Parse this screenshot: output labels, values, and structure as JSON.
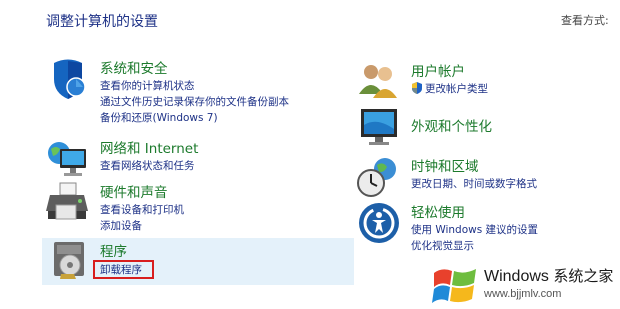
{
  "header": {
    "title": "调整计算机的设置",
    "view_by_label": "查看方式:"
  },
  "categories": {
    "system": {
      "title": "系统和安全",
      "icon": "shield-icon",
      "links": [
        "查看你的计算机状态",
        "通过文件历史记录保存你的文件备份副本",
        "备份和还原(Windows 7)"
      ]
    },
    "network": {
      "title": "网络和 Internet",
      "icon": "network-globe-icon",
      "links": [
        "查看网络状态和任务"
      ]
    },
    "hardware": {
      "title": "硬件和声音",
      "icon": "printer-icon",
      "links": [
        "查看设备和打印机",
        "添加设备"
      ]
    },
    "programs": {
      "title": "程序",
      "icon": "programs-disc-icon",
      "links": [
        "卸载程序"
      ]
    },
    "accounts": {
      "title": "用户帐户",
      "icon": "users-icon",
      "links": [
        "更改帐户类型"
      ]
    },
    "appearance": {
      "title": "外观和个性化",
      "icon": "monitor-icon",
      "links": []
    },
    "clock": {
      "title": "时钟和区域",
      "icon": "clock-globe-icon",
      "links": [
        "更改日期、时间或数字格式"
      ]
    },
    "ease": {
      "title": "轻松使用",
      "icon": "ease-of-access-icon",
      "links": [
        "使用 Windows 建议的设置",
        "优化视觉显示"
      ]
    }
  },
  "watermark": {
    "brand": "Windows",
    "brand_suffix": "系统之家",
    "url": "www.bjjmlv.com"
  },
  "colors": {
    "link_blue": "#1e3287",
    "heading_green": "#1c7a2c",
    "highlight_bg": "#e4f1fa",
    "focus_red": "#d81e1e"
  }
}
